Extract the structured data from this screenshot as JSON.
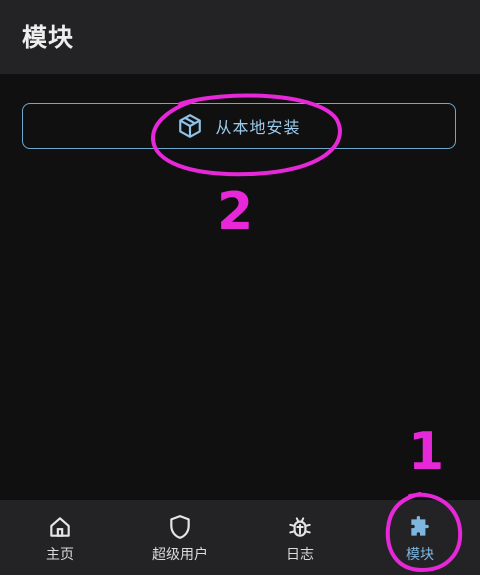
{
  "header": {
    "title": "模块"
  },
  "install_button": {
    "label": "从本地安装",
    "icon": "package-icon"
  },
  "annotations": [
    {
      "number": "2",
      "target": "install_button"
    },
    {
      "number": "1",
      "target": "nav_modules"
    }
  ],
  "bottom_nav": {
    "items": [
      {
        "label": "主页",
        "icon": "home-icon",
        "active": false
      },
      {
        "label": "超级用户",
        "icon": "shield-icon",
        "active": false
      },
      {
        "label": "日志",
        "icon": "bug-icon",
        "active": false
      },
      {
        "label": "模块",
        "icon": "puzzle-icon",
        "active": true
      }
    ]
  },
  "colors": {
    "accent": "#7fb6e0",
    "annotation": "#e628d8",
    "bar_bg": "#232325",
    "page_bg": "#101011"
  }
}
